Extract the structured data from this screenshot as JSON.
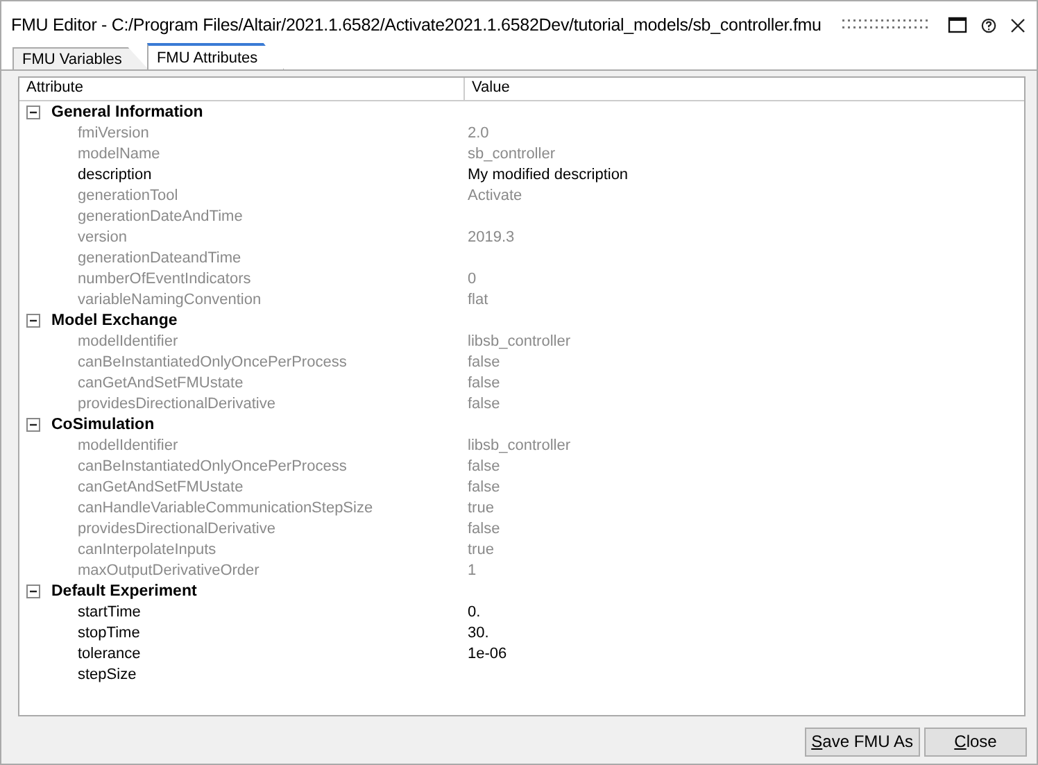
{
  "window": {
    "title": "FMU Editor - C:/Program Files/Altair/2021.1.6582/Activate2021.1.6582Dev/tutorial_models/sb_controller.fmu"
  },
  "tabs": [
    {
      "label": "FMU Variables",
      "selected": false
    },
    {
      "label": "FMU Attributes",
      "selected": true
    }
  ],
  "table": {
    "columns": [
      "Attribute",
      "Value"
    ],
    "groups": [
      {
        "name": "General Information",
        "expanded": true,
        "rows": [
          {
            "attribute": "fmiVersion",
            "value": "2.0",
            "editable": false
          },
          {
            "attribute": "modelName",
            "value": "sb_controller",
            "editable": false
          },
          {
            "attribute": "description",
            "value": "My modified description",
            "editable": true
          },
          {
            "attribute": "generationTool",
            "value": "Activate",
            "editable": false
          },
          {
            "attribute": "generationDateAndTime",
            "editable": false
          },
          {
            "attribute": "version",
            "value": "2019.3",
            "editable": false
          },
          {
            "attribute": "generationDateandTime",
            "editable": false
          },
          {
            "attribute": "numberOfEventIndicators",
            "value": "0",
            "editable": false
          },
          {
            "attribute": "variableNamingConvention",
            "value": "flat",
            "editable": false
          }
        ]
      },
      {
        "name": "Model Exchange",
        "expanded": true,
        "rows": [
          {
            "attribute": "modelIdentifier",
            "value": "libsb_controller",
            "editable": false
          },
          {
            "attribute": "canBeInstantiatedOnlyOncePerProcess",
            "value": "false",
            "editable": false
          },
          {
            "attribute": "canGetAndSetFMUstate",
            "value": "false",
            "editable": false
          },
          {
            "attribute": "providesDirectionalDerivative",
            "value": "false",
            "editable": false
          }
        ]
      },
      {
        "name": "CoSimulation",
        "expanded": true,
        "rows": [
          {
            "attribute": "modelIdentifier",
            "value": "libsb_controller",
            "editable": false
          },
          {
            "attribute": "canBeInstantiatedOnlyOncePerProcess",
            "value": "false",
            "editable": false
          },
          {
            "attribute": "canGetAndSetFMUstate",
            "value": "false",
            "editable": false
          },
          {
            "attribute": "canHandleVariableCommunicationStepSize",
            "value": "true",
            "editable": false
          },
          {
            "attribute": "providesDirectionalDerivative",
            "value": "false",
            "editable": false
          },
          {
            "attribute": "canInterpolateInputs",
            "value": "true",
            "editable": false
          },
          {
            "attribute": "maxOutputDerivativeOrder",
            "value": "1",
            "editable": false
          }
        ]
      },
      {
        "name": "Default Experiment",
        "expanded": true,
        "rows": [
          {
            "attribute": "startTime",
            "value": "0.",
            "editable": true
          },
          {
            "attribute": "stopTime",
            "value": "30.",
            "editable": true
          },
          {
            "attribute": "tolerance",
            "value": "1e-06",
            "editable": true
          },
          {
            "attribute": "stepSize",
            "editable": true
          }
        ]
      }
    ]
  },
  "buttons": [
    "Save FMU As",
    "Close"
  ]
}
